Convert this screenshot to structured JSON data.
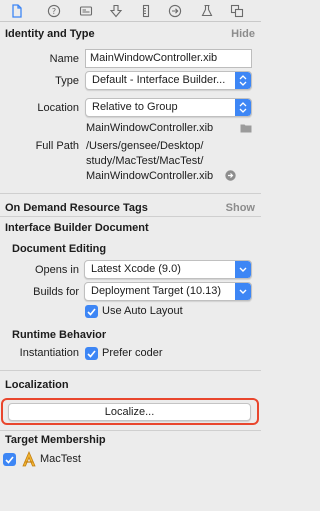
{
  "toolbar": {
    "tabs": [
      {
        "name": "file-inspector",
        "icon": "document-icon"
      },
      {
        "name": "quick-help",
        "icon": "help-icon"
      },
      {
        "name": "identity-inspector",
        "icon": "id-card-icon"
      },
      {
        "name": "attributes-inspector",
        "icon": "attributes-icon"
      },
      {
        "name": "size-inspector",
        "icon": "ruler-icon"
      },
      {
        "name": "connections-inspector",
        "icon": "arrow-circle-icon"
      },
      {
        "name": "bindings-inspector",
        "icon": "bindings-icon"
      },
      {
        "name": "effects-inspector",
        "icon": "layers-icon"
      }
    ],
    "active_color": "#3d86f5"
  },
  "identity": {
    "title": "Identity and Type",
    "hide": "Hide",
    "name_label": "Name",
    "name_value": "MainWindowController.xib",
    "type_label": "Type",
    "type_value": "Default - Interface Builder...",
    "location_label": "Location",
    "location_value": "Relative to Group",
    "location_path": "MainWindowController.xib",
    "fullpath_label": "Full Path",
    "fullpath_line1": "/Users/gensee/Desktop/",
    "fullpath_line2": "study/MacTest/MacTest/",
    "fullpath_line3": "MainWindowController.xib"
  },
  "odr": {
    "title": "On Demand Resource Tags",
    "show": "Show"
  },
  "ibdoc": {
    "title": "Interface Builder Document",
    "editing_title": "Document Editing",
    "opens_label": "Opens in",
    "opens_value": "Latest Xcode (9.0)",
    "builds_label": "Builds for",
    "builds_value": "Deployment Target (10.13)",
    "autolayout_label": "Use Auto Layout",
    "runtime_title": "Runtime Behavior",
    "instantiation_label": "Instantiation",
    "prefer_coder_label": "Prefer coder"
  },
  "localization": {
    "title": "Localization",
    "button_label": "Localize...",
    "highlight_color": "#e9462d"
  },
  "membership": {
    "title": "Target Membership",
    "target_name": "MacTest"
  }
}
